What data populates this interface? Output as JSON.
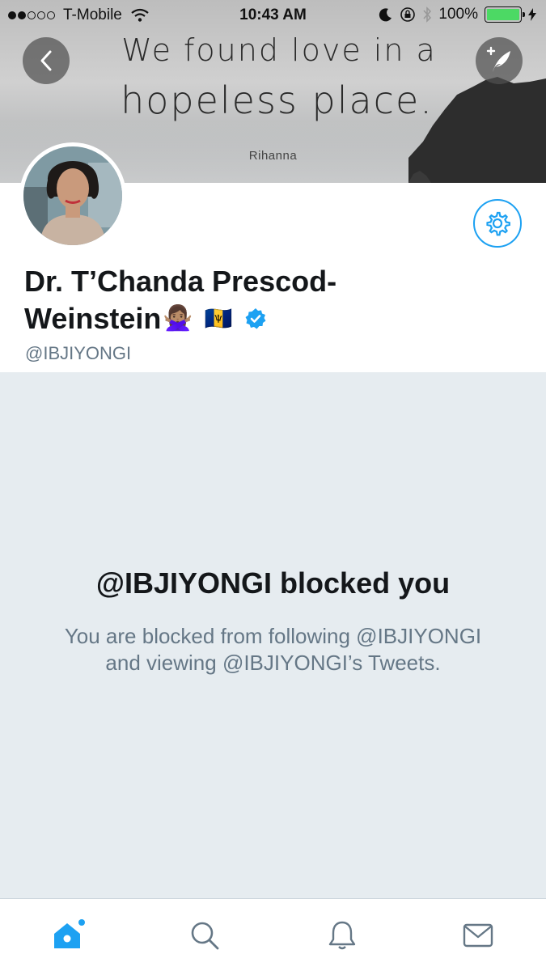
{
  "status_bar": {
    "carrier": "T-Mobile",
    "time": "10:43 AM",
    "battery": "100%",
    "battery_level": 1.0
  },
  "banner": {
    "quote_line1": "We found love in a",
    "quote_line2": "hopeless place.",
    "quote_author": "Rihanna"
  },
  "profile": {
    "name_line1": "Dr. T’Chanda Prescod-",
    "name_line2": "Weinstein",
    "name_emoji_gesture": "🙅🏽‍♀️",
    "name_emoji_flag": "🇧🇧",
    "handle": "@IBJIYONGI",
    "verified": true
  },
  "blocked": {
    "title": "@IBJIYONGI blocked you",
    "message": "You are blocked from following @IBJIYONGI and viewing @IBJIYONGI’s Tweets."
  },
  "tabs": [
    {
      "name": "home-icon",
      "active": true
    },
    {
      "name": "search-icon",
      "active": false
    },
    {
      "name": "notifications-icon",
      "active": false
    },
    {
      "name": "messages-icon",
      "active": false
    }
  ],
  "colors": {
    "accent": "#1da1f2",
    "name_text": "#14171a",
    "secondary_text": "#657786",
    "background": "#e6ecf0"
  }
}
